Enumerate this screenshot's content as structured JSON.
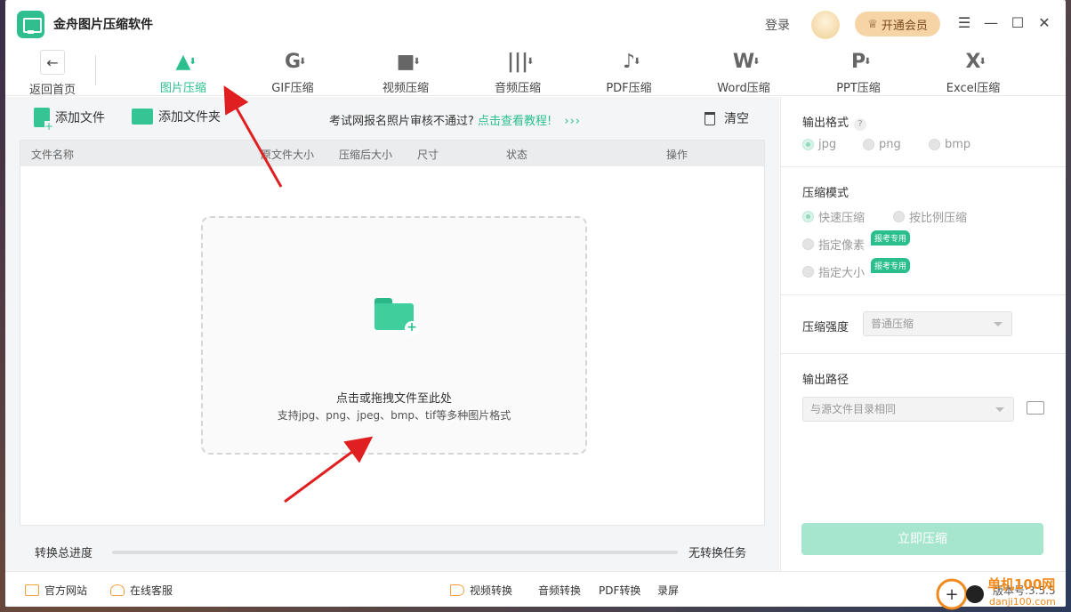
{
  "app": {
    "title": "金舟图片压缩软件"
  },
  "header": {
    "login": "登录",
    "vip": "开通会员"
  },
  "toolbar": {
    "back_label": "返回首页",
    "tools": [
      {
        "label": "图片压缩",
        "glyph": "▲",
        "active": true
      },
      {
        "label": "GIF压缩",
        "glyph": "G"
      },
      {
        "label": "视频压缩",
        "glyph": "■"
      },
      {
        "label": "音频压缩",
        "glyph": "|||"
      },
      {
        "label": "PDF压缩",
        "glyph": "♪"
      },
      {
        "label": "Word压缩",
        "glyph": "W"
      },
      {
        "label": "PPT压缩",
        "glyph": "P"
      },
      {
        "label": "Excel压缩",
        "glyph": "X"
      }
    ]
  },
  "actions": {
    "add_file": "添加文件",
    "add_folder": "添加文件夹",
    "tip_text": "考试网报名照片审核不通过?",
    "tip_link": "点击查看教程!",
    "tip_arrows": "›››",
    "clear": "清空"
  },
  "table": {
    "columns": [
      "文件名称",
      "原文件大小",
      "压缩后大小",
      "尺寸",
      "状态",
      "操作"
    ]
  },
  "dropzone": {
    "title": "点击或拖拽文件至此处",
    "subtitle": "支持jpg、png、jpeg、bmp、tif等多种图片格式"
  },
  "progress": {
    "label": "转换总进度",
    "status": "无转换任务",
    "fraction": 0
  },
  "panel": {
    "output_format": {
      "title": "输出格式",
      "help": "?",
      "options": [
        "jpg",
        "png",
        "bmp"
      ],
      "selected": "jpg"
    },
    "mode": {
      "title": "压缩模式",
      "options": [
        "快速压缩",
        "按比例压缩",
        "指定像素",
        "指定大小"
      ],
      "badge": "报考专用",
      "selected": "快速压缩"
    },
    "strength": {
      "title": "压缩强度",
      "value": "普通压缩"
    },
    "output_path": {
      "title": "输出路径",
      "value": "与源文件目录相同"
    },
    "compress_button": "立即压缩"
  },
  "footer": {
    "official_site": "官方网站",
    "support": "在线客服",
    "video_convert": "视频转换",
    "audio_convert": "音频转换",
    "pdf_convert": "PDF转换",
    "record": "录屏",
    "version": "版本号:3.5.5"
  },
  "watermark": {
    "text": "单机100网",
    "domain": "danji100.com"
  },
  "colors": {
    "accent": "#2bbf8e",
    "annotation_arrow": "#e02020",
    "vip_bg": "#f6d4a6"
  }
}
